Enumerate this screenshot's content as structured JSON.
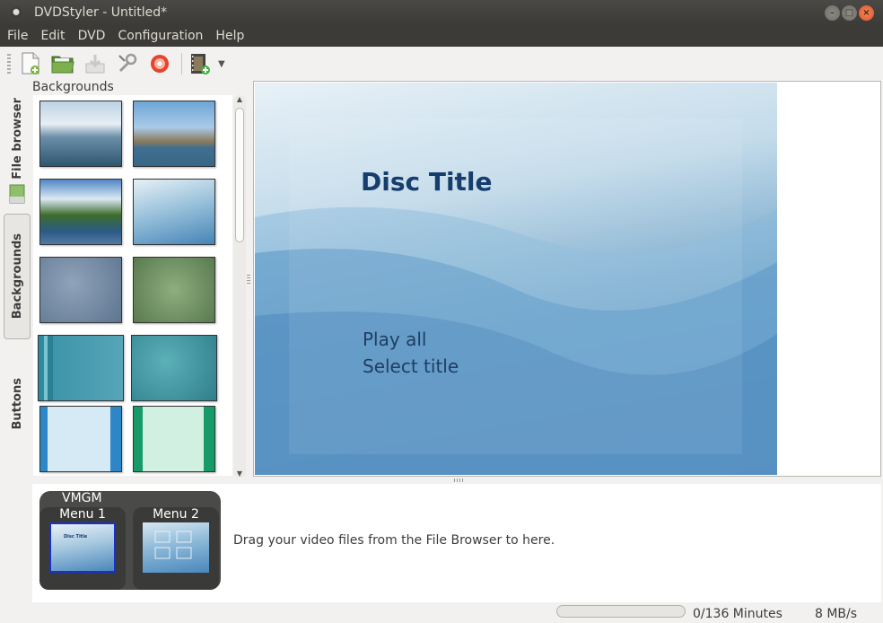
{
  "window": {
    "title": "DVDStyler - Untitled*",
    "controls": [
      "–",
      "□",
      "×"
    ]
  },
  "menubar": {
    "items": [
      "File",
      "Edit",
      "DVD",
      "Configuration",
      "Help"
    ]
  },
  "toolbar": {
    "buttons": [
      "new-file-icon",
      "open-folder-icon",
      "save-icon",
      "settings-wrench-icon",
      "burn-disc-icon",
      "add-video-icon"
    ]
  },
  "sidebar": {
    "tabs": [
      "File browser",
      "Backgrounds",
      "Buttons"
    ],
    "active_tab": "Backgrounds"
  },
  "backgrounds_panel": {
    "title": "Backgrounds"
  },
  "menu_preview": {
    "title": "Disc Title",
    "items": [
      "Play all",
      "Select title"
    ]
  },
  "titleset": {
    "group_label": "VMGM",
    "menus": [
      "Menu 1",
      "Menu 2"
    ],
    "menu1_preview_title": "Disc Title",
    "drag_hint": "Drag your video files from the File Browser to here."
  },
  "status": {
    "minutes": "0/136 Minutes",
    "rate": "8 MB/s",
    "progress": 0
  }
}
